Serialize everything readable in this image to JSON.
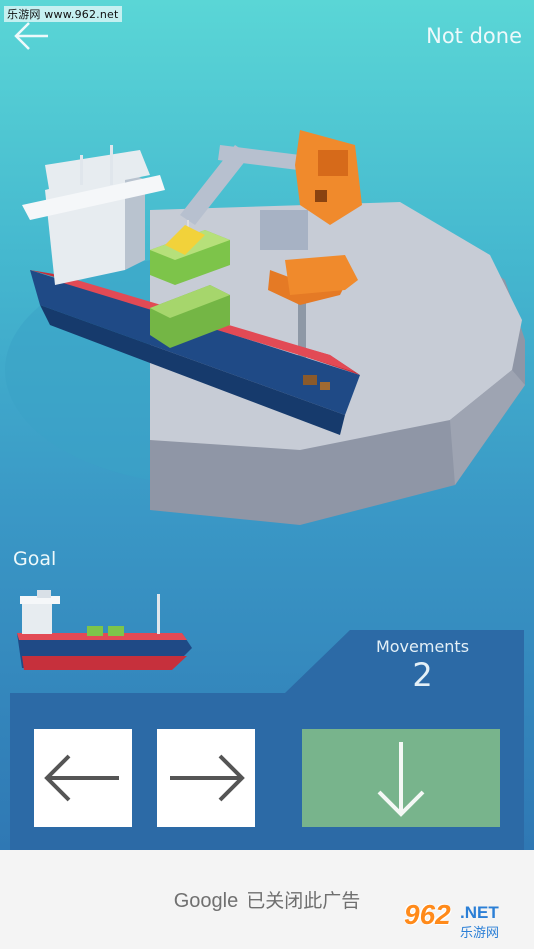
{
  "watermark": {
    "site": "乐游网 www.962.net"
  },
  "header": {
    "back_icon": "arrow-left-icon",
    "status": "Not done"
  },
  "goal": {
    "label": "Goal"
  },
  "movements": {
    "label": "Movements",
    "value": "2"
  },
  "controls": [
    {
      "action": "move-left",
      "icon": "arrow-left-icon"
    },
    {
      "action": "move-right",
      "icon": "arrow-right-icon"
    },
    {
      "action": "drop",
      "icon": "arrow-down-icon"
    }
  ],
  "ad": {
    "brand": "Google",
    "text": "已关闭此广告"
  },
  "logo": {
    "number": "962",
    "suffix": ".NET",
    "subtitle": "乐游网"
  },
  "colors": {
    "control_button": "#ffffff",
    "drop_button": "#78b48c",
    "hull_navy": "#1f4a86",
    "deck_red": "#c6303c",
    "container_green": "#7dc44a",
    "crane_orange": "#f08a2c",
    "platform_gray": "#b8bfcc"
  }
}
